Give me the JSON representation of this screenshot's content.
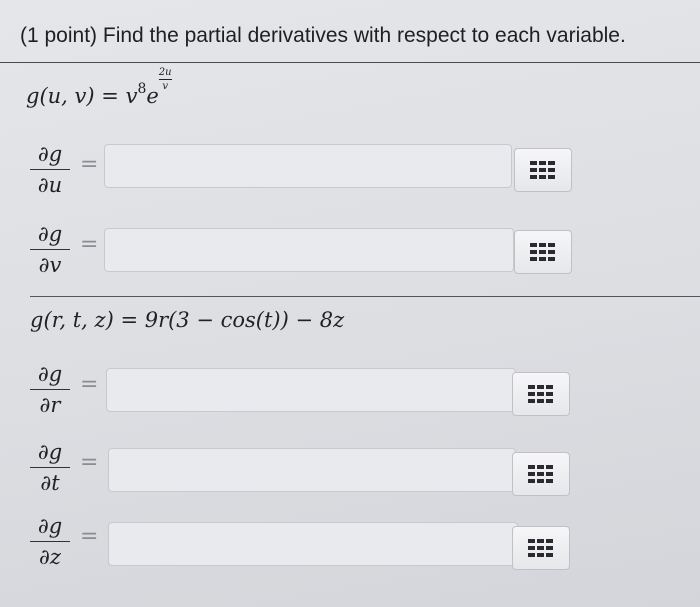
{
  "problem": {
    "text": "(1 point) Find the partial derivatives with respect to each variable."
  },
  "part1": {
    "formula": {
      "lhs": "g(u, v)",
      "eq": "=",
      "base": "v",
      "exp": "8",
      "e": "e",
      "frac_num": "2u",
      "frac_den": "v"
    },
    "rows": [
      {
        "num": "∂g",
        "den": "∂u",
        "eq": "=",
        "value": "",
        "button_icon": "matrix-grid-icon"
      },
      {
        "num": "∂g",
        "den": "∂v",
        "eq": "=",
        "value": "",
        "button_icon": "matrix-grid-icon"
      }
    ]
  },
  "part2": {
    "formula": {
      "text": "g(r, t, z) = 9r(3 − cos(t)) − 8z"
    },
    "rows": [
      {
        "num": "∂g",
        "den": "∂r",
        "eq": "=",
        "value": "",
        "button_icon": "matrix-grid-icon"
      },
      {
        "num": "∂g",
        "den": "∂t",
        "eq": "=",
        "value": "",
        "button_icon": "matrix-grid-icon"
      },
      {
        "num": "∂g",
        "den": "∂z",
        "eq": "=",
        "value": "",
        "button_icon": "matrix-grid-icon"
      }
    ]
  },
  "colors": {
    "page_bg": "#dfe1e5",
    "field_bg": "#e9eaee",
    "button_bg": "#eeeff1",
    "text": "#1f1f23"
  }
}
